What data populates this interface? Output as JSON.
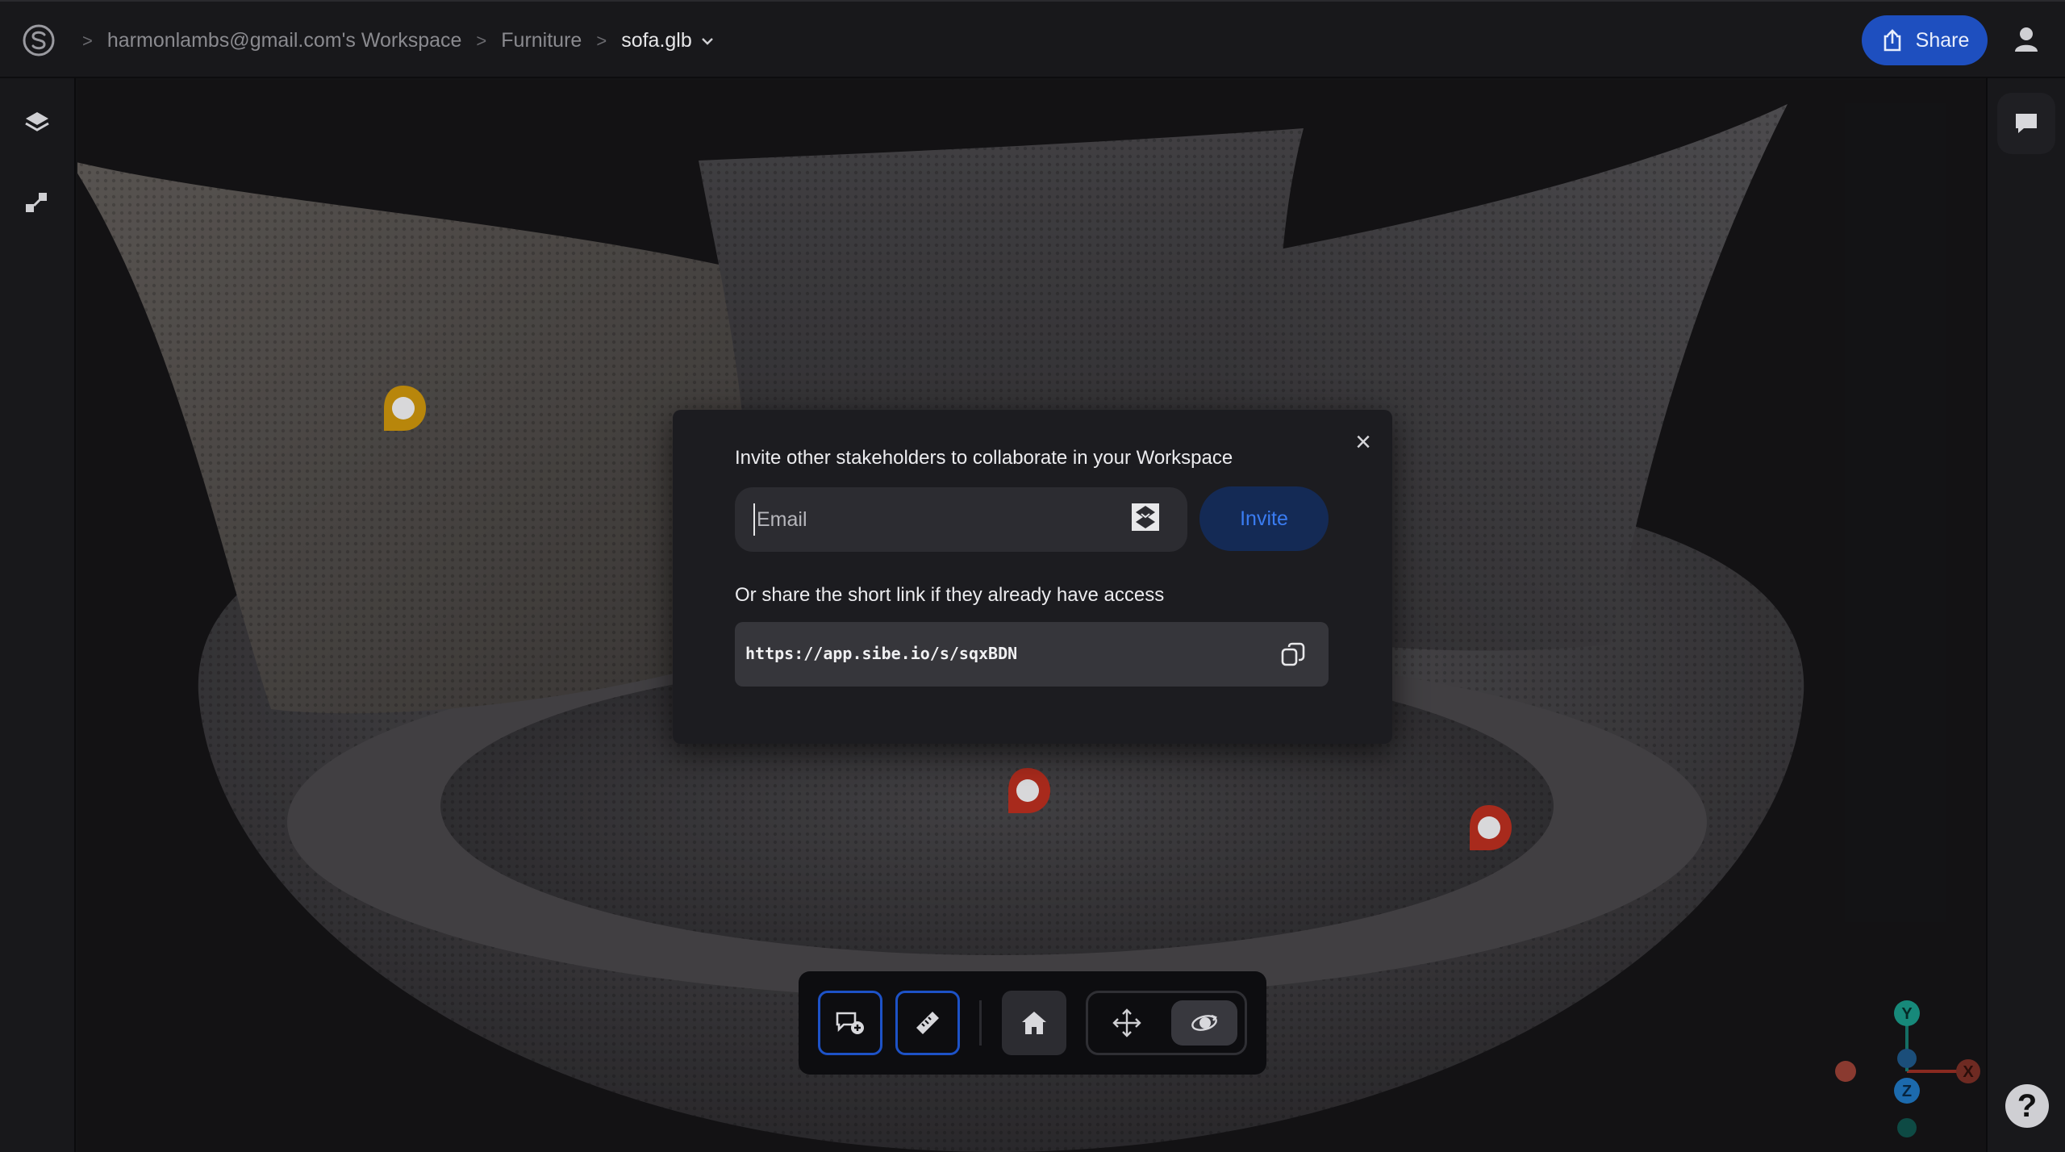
{
  "header": {
    "breadcrumb": [
      "harmonlambs@gmail.com's Workspace",
      "Furniture",
      "sofa.glb"
    ],
    "separator": ">",
    "share_label": "Share"
  },
  "left_rail": {
    "items": [
      "layers-icon",
      "scene-graph-icon"
    ]
  },
  "right_rail": {
    "items": [
      "comments-icon"
    ],
    "help_label": "?"
  },
  "invite_dialog": {
    "title": "Invite other stakeholders to collaborate in your Workspace",
    "email_placeholder": "Email",
    "email_value": "",
    "invite_label": "Invite",
    "share_hint": "Or share the short link if they already have access",
    "short_link": "https://app.sibe.io/s/sqxBDN",
    "close_label": "×"
  },
  "annotation_pins": [
    {
      "color": "#c8920f",
      "name": "pin-yellow"
    },
    {
      "color": "#b83222",
      "name": "pin-red-1"
    },
    {
      "color": "#b83222",
      "name": "pin-red-2"
    }
  ],
  "toolbar": {
    "items": [
      "add-comment-icon",
      "measure-icon",
      "home-icon",
      "pan-icon",
      "orbit-icon"
    ]
  },
  "axis_gizmo": {
    "labels": {
      "x": "X",
      "y": "Y",
      "z": "Z"
    },
    "colors": {
      "x": "#c8463a",
      "y": "#1fae9a",
      "z": "#2b86d6"
    }
  },
  "theme": {
    "accent": "#1e4fbf",
    "background": "#18181b"
  }
}
